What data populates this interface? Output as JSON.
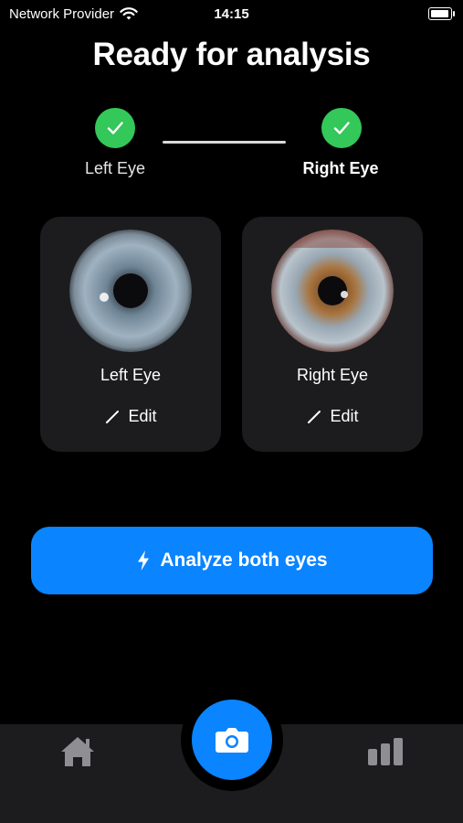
{
  "status_bar": {
    "carrier": "Network Provider",
    "time": "14:15"
  },
  "title": "Ready for analysis",
  "stepper": {
    "left_label": "Left Eye",
    "right_label": "Right Eye",
    "left_complete": true,
    "right_complete": true
  },
  "cards": [
    {
      "label": "Left Eye",
      "edit_label": "Edit"
    },
    {
      "label": "Right Eye",
      "edit_label": "Edit"
    }
  ],
  "analyze_button": {
    "label": "Analyze both eyes",
    "icon": "bolt-icon"
  },
  "tab_bar": {
    "items": [
      {
        "icon": "home-icon"
      },
      {
        "icon": "camera-icon"
      },
      {
        "icon": "bar-chart-icon"
      }
    ]
  },
  "colors": {
    "accent": "#0a84ff",
    "success": "#34c759",
    "card": "#1c1c1e",
    "background": "#000000"
  }
}
